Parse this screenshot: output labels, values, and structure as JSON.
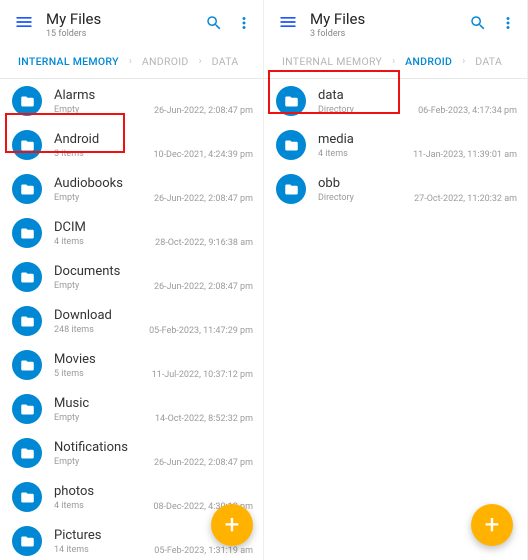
{
  "left": {
    "title": "My Files",
    "subtitle": "15 folders",
    "breadcrumbs": [
      {
        "label": "INTERNAL MEMORY",
        "active": true
      },
      {
        "label": "ANDROID",
        "active": false
      },
      {
        "label": "DATA",
        "active": false
      }
    ],
    "items": [
      {
        "name": "Alarms",
        "sub": "Empty",
        "date": "26-Jun-2022, 2:08:47 pm"
      },
      {
        "name": "Android",
        "sub": "3 items",
        "date": "10-Dec-2021, 4:24:39 pm"
      },
      {
        "name": "Audiobooks",
        "sub": "Empty",
        "date": "26-Jun-2022, 2:08:47 pm"
      },
      {
        "name": "DCIM",
        "sub": "4 items",
        "date": "28-Oct-2022, 9:16:38 am"
      },
      {
        "name": "Documents",
        "sub": "Empty",
        "date": "26-Jun-2022, 2:08:47 pm"
      },
      {
        "name": "Download",
        "sub": "248 items",
        "date": "05-Feb-2023, 11:47:29 pm"
      },
      {
        "name": "Movies",
        "sub": "5 items",
        "date": "11-Jul-2022, 10:37:12 pm"
      },
      {
        "name": "Music",
        "sub": "Empty",
        "date": "14-Oct-2022, 8:52:32 pm"
      },
      {
        "name": "Notifications",
        "sub": "Empty",
        "date": "26-Jun-2022, 2:08:47 pm"
      },
      {
        "name": "photos",
        "sub": "4 items",
        "date": "08-Dec-2022, 4:30:12 pm"
      },
      {
        "name": "Pictures",
        "sub": "14 items",
        "date": "05-Feb-2023, 1:31:19 am"
      }
    ]
  },
  "right": {
    "title": "My Files",
    "subtitle": "3 folders",
    "breadcrumbs": [
      {
        "label": "INTERNAL MEMORY",
        "active": false
      },
      {
        "label": "ANDROID",
        "active": true
      },
      {
        "label": "DATA",
        "active": false
      }
    ],
    "items": [
      {
        "name": "data",
        "sub": "Directory",
        "date": "06-Feb-2023, 4:17:34 pm"
      },
      {
        "name": "media",
        "sub": "4 items",
        "date": "11-Jan-2023, 11:39:01 am"
      },
      {
        "name": "obb",
        "sub": "Directory",
        "date": "27-Oct-2022, 11:20:32 am"
      }
    ]
  }
}
